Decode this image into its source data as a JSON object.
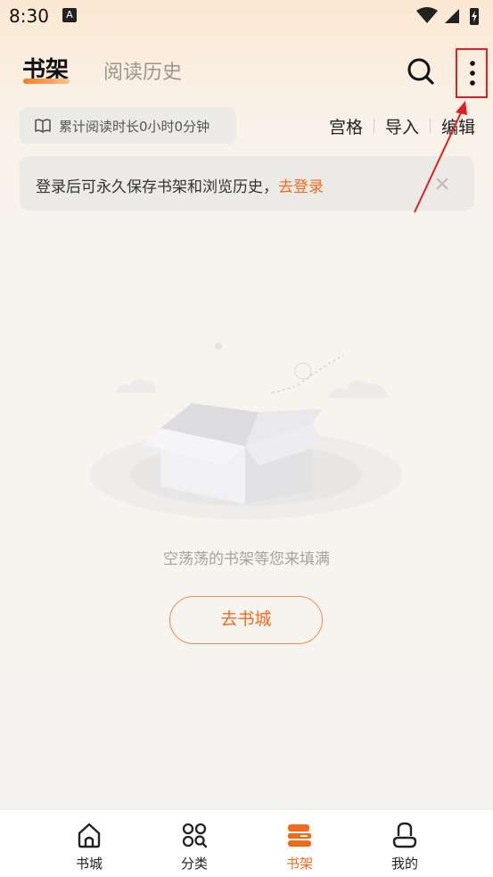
{
  "status_bar": {
    "time": "8:30",
    "a_badge": "A"
  },
  "header": {
    "tabs": [
      {
        "label": "书架",
        "active": true
      },
      {
        "label": "阅读历史",
        "active": false
      }
    ],
    "search_icon": "search-icon",
    "more_icon": "more-vertical-icon"
  },
  "reading_stats": {
    "text": "累计阅读时长0小时0分钟",
    "icon": "open-book-icon"
  },
  "toolbar": {
    "grid_label": "宫格",
    "import_label": "导入",
    "edit_label": "编辑"
  },
  "login_banner": {
    "text": "登录后可永久保存书架和浏览历史，",
    "link": "去登录",
    "close_icon": "close-icon"
  },
  "empty_state": {
    "message": "空荡荡的书架等您来填满",
    "button_label": "去书城",
    "illustration": "empty-box-illustration"
  },
  "bottom_nav": [
    {
      "label": "书城",
      "icon": "home-icon",
      "active": false
    },
    {
      "label": "分类",
      "icon": "category-icon",
      "active": false
    },
    {
      "label": "书架",
      "icon": "bookshelf-icon",
      "active": true
    },
    {
      "label": "我的",
      "icon": "profile-icon",
      "active": false
    }
  ],
  "colors": {
    "accent": "#f26b1d",
    "annotation_red": "#e02020",
    "background": "#f6f4f0"
  }
}
